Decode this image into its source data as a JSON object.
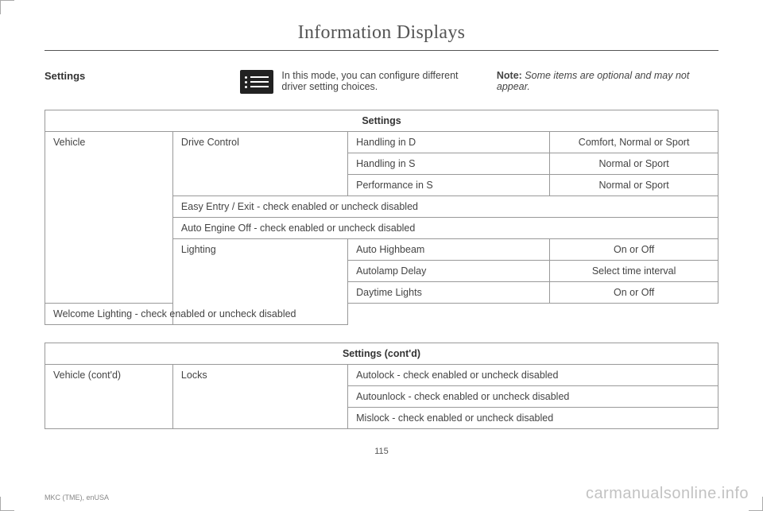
{
  "page_title": "Information Displays",
  "intro": {
    "heading": "Settings",
    "description": "In this mode, you can configure different driver setting choices.",
    "note_label": "Note:",
    "note_text": " Some items are optional and may not appear."
  },
  "table1": {
    "header": "Settings",
    "cat1": "Vehicle",
    "sub_drive": "Drive Control",
    "dc_rows": [
      {
        "param": "Handling in D",
        "opts": "Comfort, Normal or Sport"
      },
      {
        "param": "Handling in S",
        "opts": "Normal or Sport"
      },
      {
        "param": "Performance in S",
        "opts": "Normal or Sport"
      }
    ],
    "easy_entry": "Easy Entry / Exit - check enabled or uncheck disabled",
    "auto_engine": "Auto Engine Off - check enabled or uncheck disabled",
    "sub_lighting": "Lighting",
    "light_rows": [
      {
        "param": "Auto Highbeam",
        "opts": "On or Off"
      },
      {
        "param": "Autolamp Delay",
        "opts": "Select time interval"
      },
      {
        "param": "Daytime Lights",
        "opts": "On or Off"
      }
    ],
    "welcome_lighting": "Welcome Lighting - check enabled or uncheck disabled"
  },
  "table2": {
    "header": "Settings (cont'd)",
    "cat1": "Vehicle (cont'd)",
    "sub_locks": "Locks",
    "lock_rows": [
      "Autolock - check enabled or uncheck disabled",
      "Autounlock - check enabled or uncheck disabled",
      "Mislock - check enabled or uncheck disabled"
    ]
  },
  "page_number": "115",
  "footer_left": "MKC (TME), enUSA",
  "watermark": "carmanualsonline.info"
}
